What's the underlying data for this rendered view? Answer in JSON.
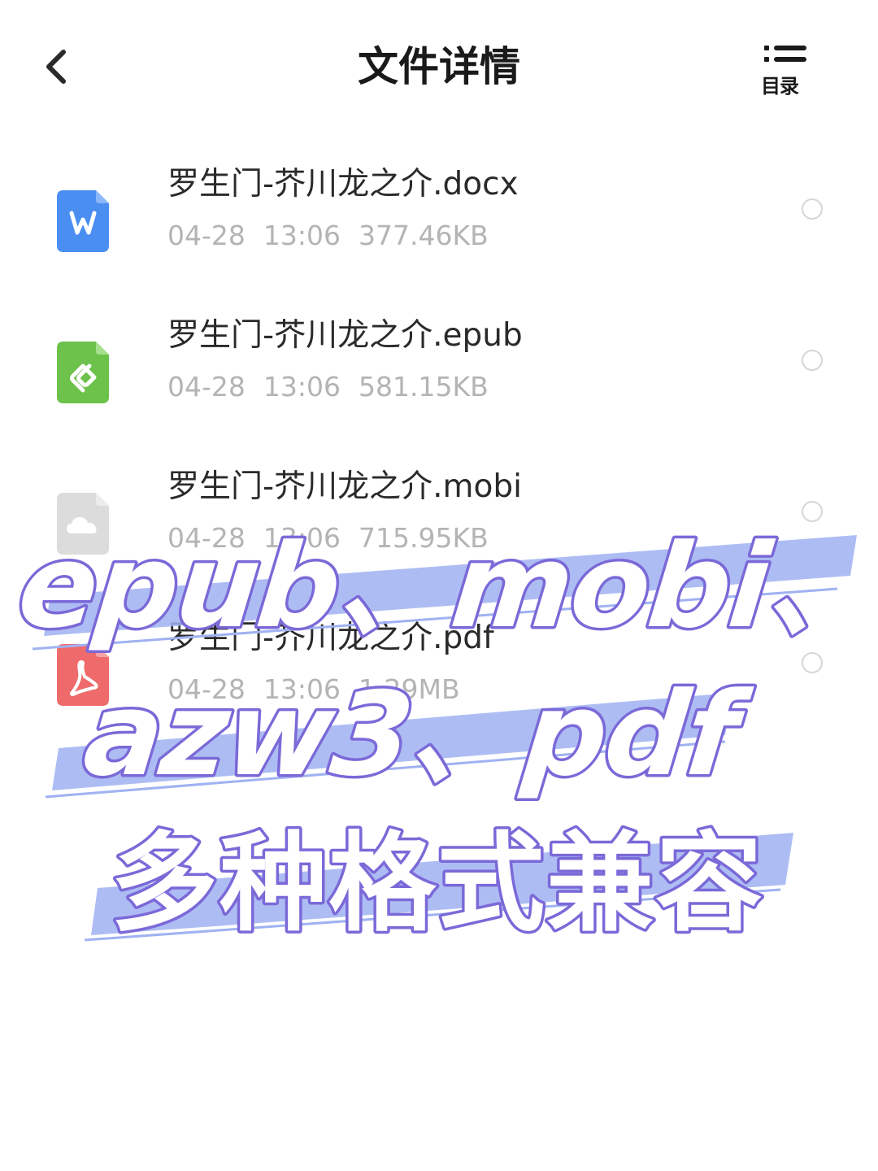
{
  "header": {
    "title": "文件详情",
    "toc_label": "目录"
  },
  "files": [
    {
      "name": "罗生门-芥川龙之介.docx",
      "date": "04-28",
      "time": "13:06",
      "size": "377.46KB",
      "icon": "word-file-icon",
      "color": "#4a8ef2"
    },
    {
      "name": "罗生门-芥川龙之介.epub",
      "date": "04-28",
      "time": "13:06",
      "size": "581.15KB",
      "icon": "epub-file-icon",
      "color": "#6cc24a"
    },
    {
      "name": "罗生门-芥川龙之介.mobi",
      "date": "04-28",
      "time": "13:06",
      "size": "715.95KB",
      "icon": "cloud-file-icon",
      "color": "#d9d9d9"
    },
    {
      "name": "罗生门-芥川龙之介.pdf",
      "date": "04-28",
      "time": "13:06",
      "size": "1.29MB",
      "icon": "pdf-file-icon",
      "color": "#ef6b6b"
    }
  ],
  "overlay": {
    "line1": "epub、mobi、",
    "line2": "azw3、pdf",
    "line3": "多种格式兼容",
    "text_fill": "#ffffff",
    "text_stroke": "#7b69d8",
    "stripe_color": "#9fb2f2"
  }
}
